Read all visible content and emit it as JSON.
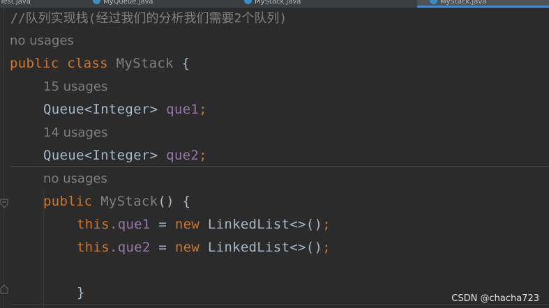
{
  "tabs": [
    {
      "label": "Test.java"
    },
    {
      "label": "MyQueue.java"
    },
    {
      "label": "MyStack.java"
    },
    {
      "label": "MyStack.java"
    }
  ],
  "editor": {
    "comment": "//队列实现栈(经过我们的分析我们需要2个队列)",
    "usages_class": "no usages",
    "class_decl": {
      "public": "public",
      "class": "class",
      "name": "MyStack",
      "brace": "{"
    },
    "usages_que1": "15 usages",
    "field1": {
      "type": "Queue<Integer>",
      "name": "que1",
      "semi": ";"
    },
    "usages_que2": "14 usages",
    "field2": {
      "type": "Queue<Integer>",
      "name": "que2",
      "semi": ";"
    },
    "usages_ctor": "no usages",
    "ctor": {
      "public": "public",
      "name": "MyStack",
      "paren_brace": "() {"
    },
    "stmt1": {
      "this": "this",
      "dot_field": ".que1",
      "assign": " = ",
      "new": "new",
      "rhs": " LinkedList<>()",
      "semi": ";"
    },
    "stmt2": {
      "this": "this",
      "dot_field": ".que2",
      "assign": " = ",
      "new": "new",
      "rhs": " LinkedList<>()",
      "semi": ";"
    },
    "close_brace": "}"
  },
  "watermark": "CSDN @chacha723",
  "colors": {
    "keyword": "#cc7832",
    "field": "#9876aa",
    "default_text": "#a9b7c6",
    "hint": "#7f7f7f",
    "comment": "#808080",
    "background": "#2b2b2b"
  }
}
